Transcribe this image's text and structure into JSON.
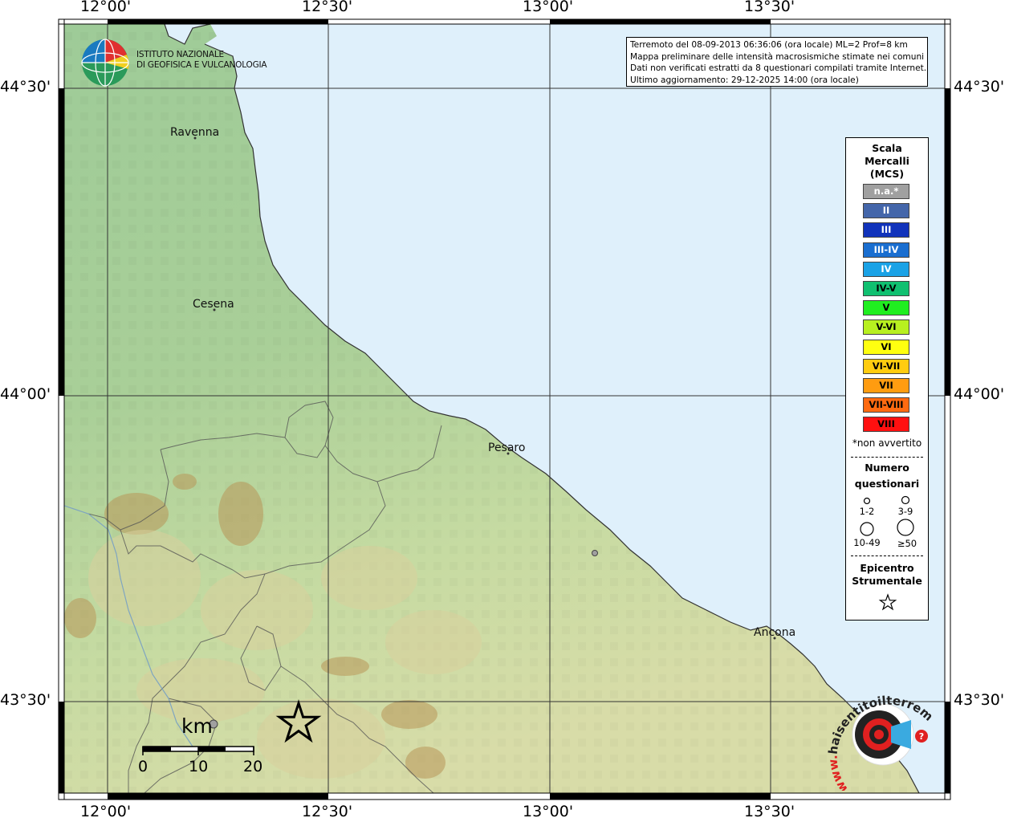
{
  "axes": {
    "top_longitudes": [
      "12°00'",
      "12°30'",
      "13°00'",
      "13°30'"
    ],
    "bottom_longitudes": [
      "12°00'",
      "12°30'",
      "13°00'",
      "13°30'"
    ],
    "left_latitudes": [
      "44°30'",
      "44°00'",
      "43°30'"
    ],
    "right_latitudes": [
      "44°30'",
      "44°00'",
      "43°30'"
    ]
  },
  "logo": {
    "line1": "ISTITUTO NAZIONALE",
    "line2": "DI GEOFISICA E VULCANOLOGIA"
  },
  "info": {
    "line1": "Terremoto del 08-09-2013 06:36:06 (ora locale) ML=2 Prof=8 km",
    "line2": "Mappa preliminare delle intensità macrosismiche stimate nei comuni",
    "line3": "Dati non verificati estratti da 8 questionari compilati tramite Internet.",
    "line4": "Ultimo aggiornamento: 29-12-2025 14:00 (ora locale)"
  },
  "places": {
    "ravenna": "Ravenna",
    "cesena": "Cesena",
    "pesaro": "Pesaro",
    "ancona": "Ancona"
  },
  "legend": {
    "title1": "Scala",
    "title2": "Mercalli",
    "title3": "(MCS)",
    "classes": [
      {
        "label": "n.a.*",
        "color": "#a0a0a0",
        "text": "#ffffff"
      },
      {
        "label": "II",
        "color": "#4466aa",
        "text": "#ffffff"
      },
      {
        "label": "III",
        "color": "#1133bb",
        "text": "#ffffff"
      },
      {
        "label": "III-IV",
        "color": "#1a6ed0",
        "text": "#ffffff"
      },
      {
        "label": "IV",
        "color": "#1aa2e6",
        "text": "#ffffff"
      },
      {
        "label": "IV-V",
        "color": "#10c070",
        "text": "#000000"
      },
      {
        "label": "V",
        "color": "#20ee20",
        "text": "#000000"
      },
      {
        "label": "V-VI",
        "color": "#b8f020",
        "text": "#000000"
      },
      {
        "label": "VI",
        "color": "#ffff10",
        "text": "#000000"
      },
      {
        "label": "VI-VII",
        "color": "#ffcc10",
        "text": "#000000"
      },
      {
        "label": "VII",
        "color": "#ff9c10",
        "text": "#000000"
      },
      {
        "label": "VII-VIII",
        "color": "#ff6a10",
        "text": "#000000"
      },
      {
        "label": "VIII",
        "color": "#ff1010",
        "text": "#000000"
      }
    ],
    "note": "*non avvertito",
    "questionnaires_title1": "Numero",
    "questionnaires_title2": "questionari",
    "q1": "1-2",
    "q2": "3-9",
    "q3": "10-49",
    "q4": "≥50",
    "epicenter_title1": "Epicentro",
    "epicenter_title2": "Strumentale"
  },
  "scalebar": {
    "unit": "km",
    "labels": [
      "0",
      "10",
      "20"
    ]
  },
  "badge": {
    "text": "haisentitoilterremoto.it",
    "prefix": "www."
  },
  "colors": {
    "sea": "#dff0fb",
    "land_low": "#9fcc9a",
    "land_mid": "#cfe0a4",
    "land_high": "#c3a468"
  }
}
